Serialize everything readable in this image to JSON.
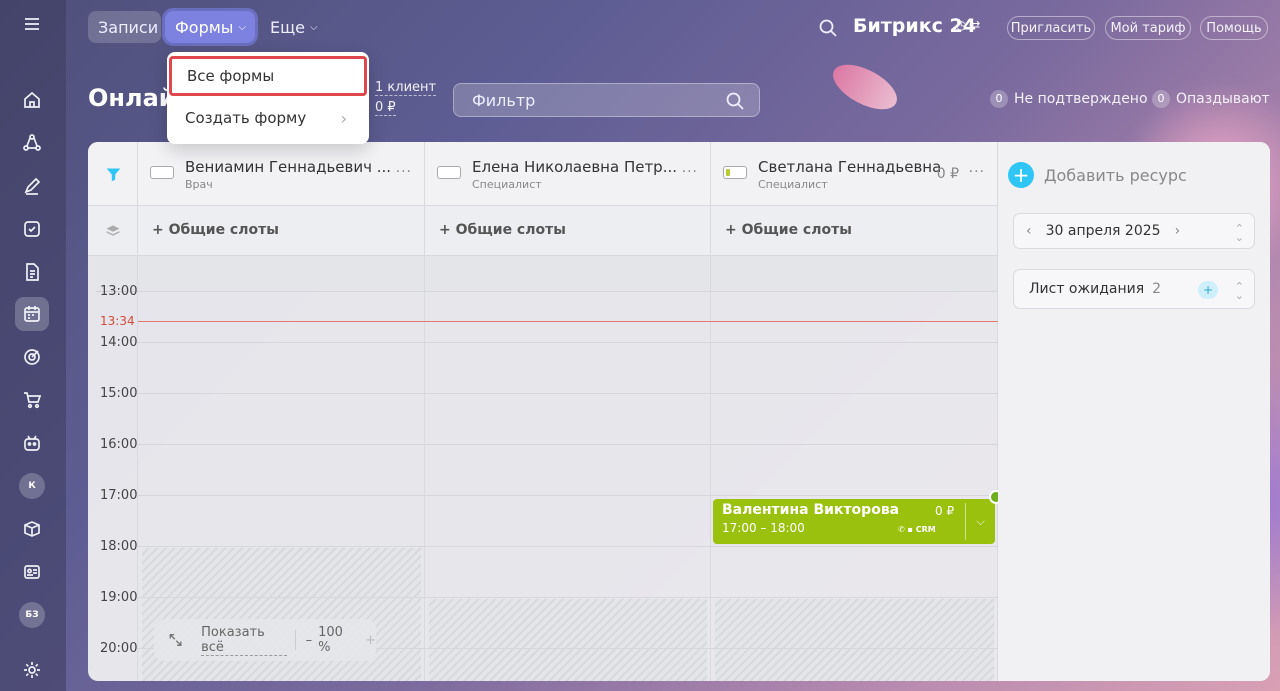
{
  "sidebar": {
    "menu_icon": "menu-icon",
    "items": [
      "home-icon",
      "share-icon",
      "pen-icon",
      "checkbox-icon",
      "doc-icon",
      "calendar-icon",
      "target-icon",
      "cart-icon",
      "robot-icon"
    ],
    "avatar1": "К",
    "after_items": [
      "box-icon",
      "card-icon"
    ],
    "avatar2": "БЗ",
    "settings_icon": "gear-icon"
  },
  "topbar": {
    "tabs": [
      {
        "label": "Записи"
      },
      {
        "label": "Формы"
      },
      {
        "label": "Еще"
      }
    ],
    "brand": "Битрикс 24",
    "invite": "Пригласить",
    "tariff": "Мой тариф",
    "help": "Помощь"
  },
  "header": {
    "title": "Онлай",
    "clients": "1 клиент",
    "sum": "0 ₽",
    "filter_placeholder": "Фильтр",
    "unconfirmed": {
      "count": "0",
      "label": "Не подтверждено"
    },
    "late": {
      "count": "0",
      "label": "Опаздывают"
    }
  },
  "resources": [
    {
      "name": "Вениамин Геннадьевич ...",
      "role": "Врач"
    },
    {
      "name": "Елена Николаевна Петр...",
      "role": "Специалист"
    },
    {
      "name": "Светлана Геннадьевна",
      "role": "Специалист",
      "price": "0 ₽"
    }
  ],
  "more_dots": "···",
  "slots_label": "+ Общие слоты",
  "times": [
    "13:00",
    "14:00",
    "15:00",
    "16:00",
    "17:00",
    "18:00",
    "19:00",
    "20:00"
  ],
  "now": "13:34",
  "booking": {
    "name": "Валентина Викторова",
    "time": "17:00 – 18:00",
    "price": "0 ₽",
    "crm": "CRM"
  },
  "right_panel": {
    "add_resource": "Добавить ресурс",
    "date": "30 апреля 2025",
    "waitlist_label": "Лист ожидания",
    "waitlist_count": "2"
  },
  "zoom": {
    "show_all": "Показать всё",
    "minus": "–",
    "value": "100 %",
    "plus": "+"
  },
  "menu": {
    "items": [
      {
        "label": "Все формы"
      },
      {
        "label": "Создать форму"
      }
    ]
  }
}
